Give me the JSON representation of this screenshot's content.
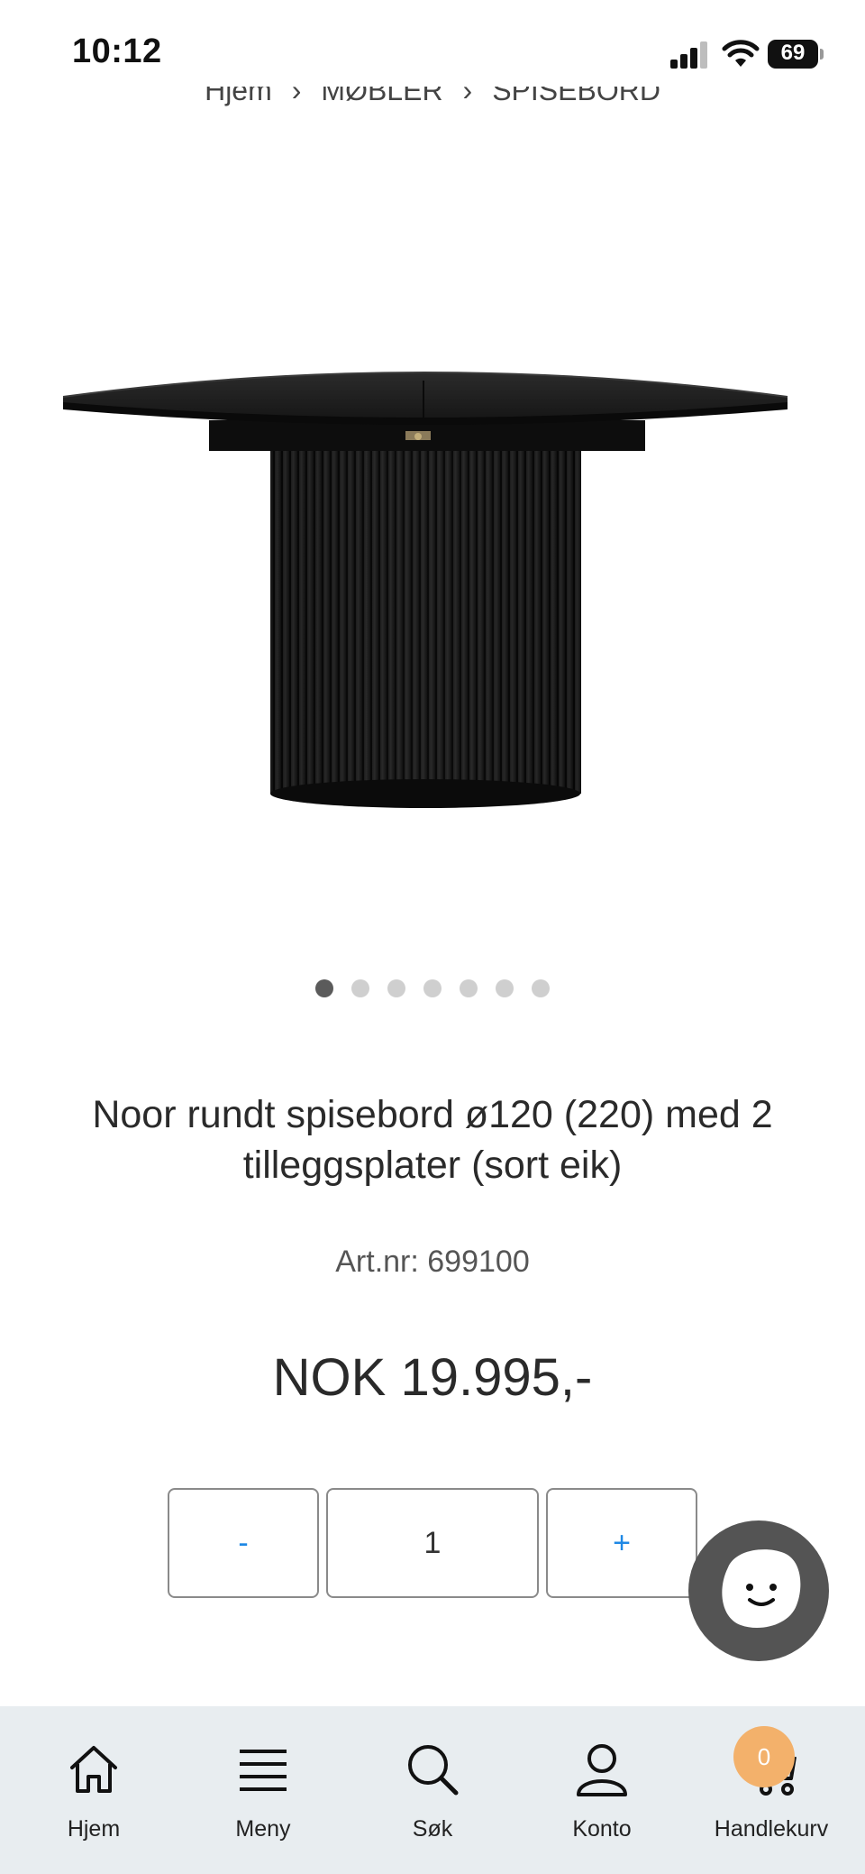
{
  "status_bar": {
    "time": "10:12",
    "battery": "69"
  },
  "breadcrumb": {
    "items": [
      "Hjem",
      "MØBLER",
      "SPISEBORD"
    ]
  },
  "product": {
    "image_icon": "round-pedestal-dining-table-image",
    "carousel": {
      "total": 7,
      "active_index": 0
    },
    "title": "Noor rundt spisebord ø120 (220) med 2 tilleggsplater (sort eik)",
    "title_line1": "Noor rundt spisebord ø120 (220) med 2",
    "title_line2": "tilleggsplater (sort eik)",
    "sku": "Art.nr: 699100",
    "price": "NOK 19.995,-"
  },
  "quantity": {
    "minus_label": "-",
    "value": "1",
    "plus_label": "+"
  },
  "chat": {
    "icon": "chat-smiley-icon"
  },
  "bottom_nav": {
    "items": [
      {
        "label": "Hjem",
        "icon": "home-icon"
      },
      {
        "label": "Meny",
        "icon": "menu-icon"
      },
      {
        "label": "Søk",
        "icon": "search-icon"
      },
      {
        "label": "Konto",
        "icon": "user-icon"
      },
      {
        "label": "Handlekurv",
        "icon": "cart-icon"
      }
    ],
    "cart_count": "0"
  },
  "colors": {
    "accent_blue": "#1e88e5",
    "badge_orange": "#f3b16b",
    "nav_background": "#e8edf0",
    "chat_grey": "#545454"
  }
}
